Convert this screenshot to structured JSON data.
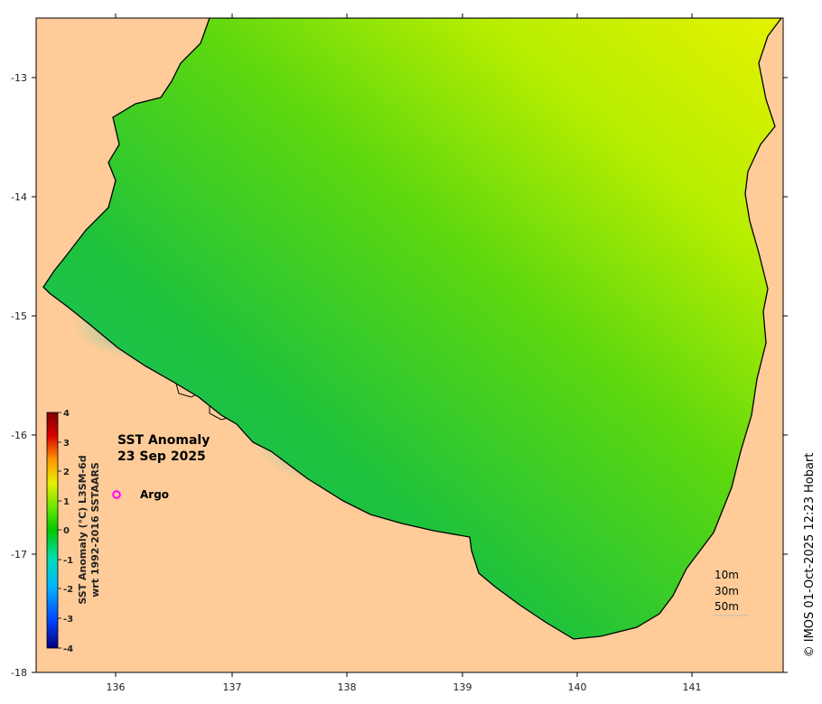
{
  "map": {
    "title_line1": "SST Anomaly",
    "title_line2": "23 Sep 2025",
    "legend_marker_label": "Argo",
    "legend_marker_color": "#ff00ff",
    "depth_contours": [
      "10m",
      "30m",
      "50m"
    ],
    "credit": "© IMOS 01-Oct-2025 12:23 Hobart",
    "land_color": "#ffcc99",
    "contour_color": "#bbbbbb"
  },
  "axes": {
    "lon_ticks": [
      "136",
      "137",
      "138",
      "139",
      "140",
      "141"
    ],
    "lat_ticks": [
      "-13",
      "-14",
      "-15",
      "-16",
      "-17",
      "-18"
    ]
  },
  "colorbar": {
    "label_line1": "SST Anomaly (°C) L3SM-6d",
    "label_line2": "wrt 1992-2016 SSTAARS",
    "ticks": [
      "4",
      "3",
      "2",
      "1",
      "0",
      "-1",
      "-2",
      "-3",
      "-4"
    ],
    "colors": [
      "#00007f",
      "#0046ff",
      "#00b4ff",
      "#00dcb4",
      "#00c800",
      "#6ee600",
      "#e6f000",
      "#ff9600",
      "#dc0000",
      "#7f0000"
    ]
  }
}
